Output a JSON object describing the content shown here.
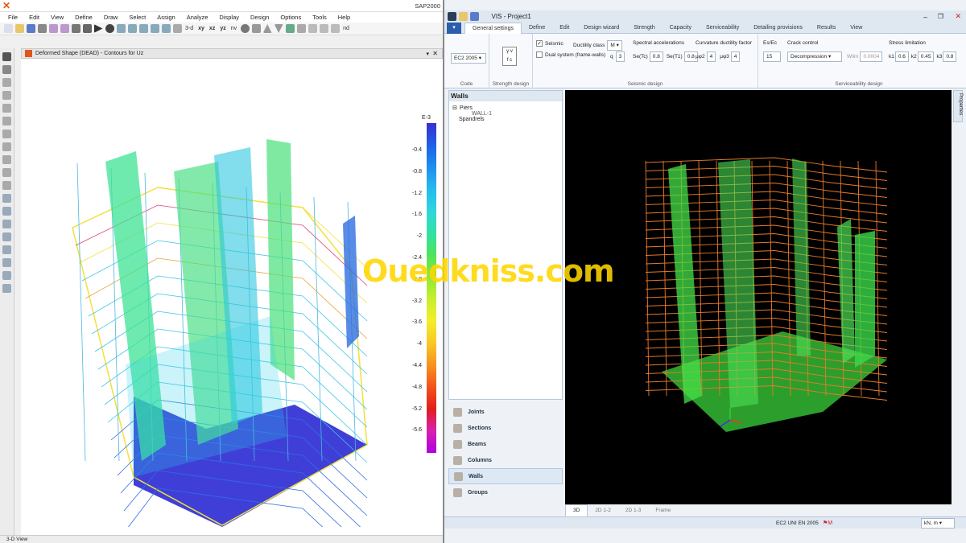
{
  "sap": {
    "app_title": "SAP2000",
    "menu": [
      "File",
      "Edit",
      "View",
      "Define",
      "Draw",
      "Select",
      "Assign",
      "Analyze",
      "Display",
      "Design",
      "Options",
      "Tools",
      "Help"
    ],
    "toolbar_text": [
      "3-d",
      "xy",
      "xz",
      "yz",
      "nv",
      "nd"
    ],
    "window_title": "Deformed Shape (DEAD) - Contours for Uz",
    "status": "3-D View",
    "legend_exponent": "E-3",
    "legend_ticks": [
      "-0.4",
      "-0.8",
      "-1.2",
      "-1.6",
      "-2",
      "-2.4",
      "-2.8",
      "-3.2",
      "-3.6",
      "-4",
      "-4.4",
      "-4.8",
      "-5.2",
      "-5.6"
    ],
    "legend_colors": [
      "#3a2fd0",
      "#1f5fe6",
      "#1e8fef",
      "#27b9ef",
      "#2ed6dc",
      "#33e0a6",
      "#4fe35a",
      "#8fe83a",
      "#c8ee2e",
      "#f3ee2a",
      "#f8c823",
      "#f7931f",
      "#f1531c",
      "#e41b1b",
      "#d621b0",
      "#b000e0"
    ]
  },
  "vis": {
    "title": "VIS - Project1",
    "tabs": [
      "General settings",
      "Define",
      "Edit",
      "Design wizard",
      "Strength",
      "Capacity",
      "Serviceability",
      "Detailing provisions",
      "Results",
      "View"
    ],
    "code": {
      "value": "EC2 2005",
      "caption": "Code"
    },
    "strength_caption": "Strength design",
    "seismic": {
      "seismic_label": "Seismic",
      "seismic_checked": true,
      "dual_label": "Dual system (frame-walls)",
      "ductility_label": "Ductility class",
      "ductility_value": "M",
      "q_label": "q",
      "q_value": "3",
      "spectral_title": "Spectral accelerations",
      "setc_label": "Se(Tc)",
      "setc_value": "0.8",
      "set1_label": "Se(T1)",
      "set1_value": "0.8",
      "curv_title": "Curvature ductility factor",
      "mu2_label": "μφ2",
      "mu2_value": "4",
      "mu3_label": "μφ3",
      "mu3_value": "4",
      "caption": "Seismic design"
    },
    "service": {
      "es_title": "Es/Ec",
      "es_value": "15",
      "crack_title": "Crack control",
      "crack_value": "Decompression",
      "wlim_label": "Wlim",
      "wlim_value": "0.0004",
      "stress_title": "Stress limitation",
      "k1_label": "k1",
      "k1_value": "0.6",
      "k2_label": "k2",
      "k2_value": "0.45",
      "k3_label": "k3",
      "k3_value": "0.8",
      "caption": "Serviceability design"
    },
    "walls_panel": {
      "title": "Walls",
      "tree_root": "Piers",
      "tree_child": "WALL-1",
      "tree_second": "Spandrels"
    },
    "nav": [
      {
        "label": "Joints"
      },
      {
        "label": "Sections"
      },
      {
        "label": "Beams"
      },
      {
        "label": "Columns"
      },
      {
        "label": "Walls"
      },
      {
        "label": "Groups"
      }
    ],
    "view_tabs": [
      "3D",
      "2D 1-2",
      "2D 1-3",
      "Frame"
    ],
    "properties_label": "Properties",
    "status_code": "EC2 UNI EN 2005",
    "status_unit": "kN, m"
  },
  "watermark": "Ouedkniss.com"
}
